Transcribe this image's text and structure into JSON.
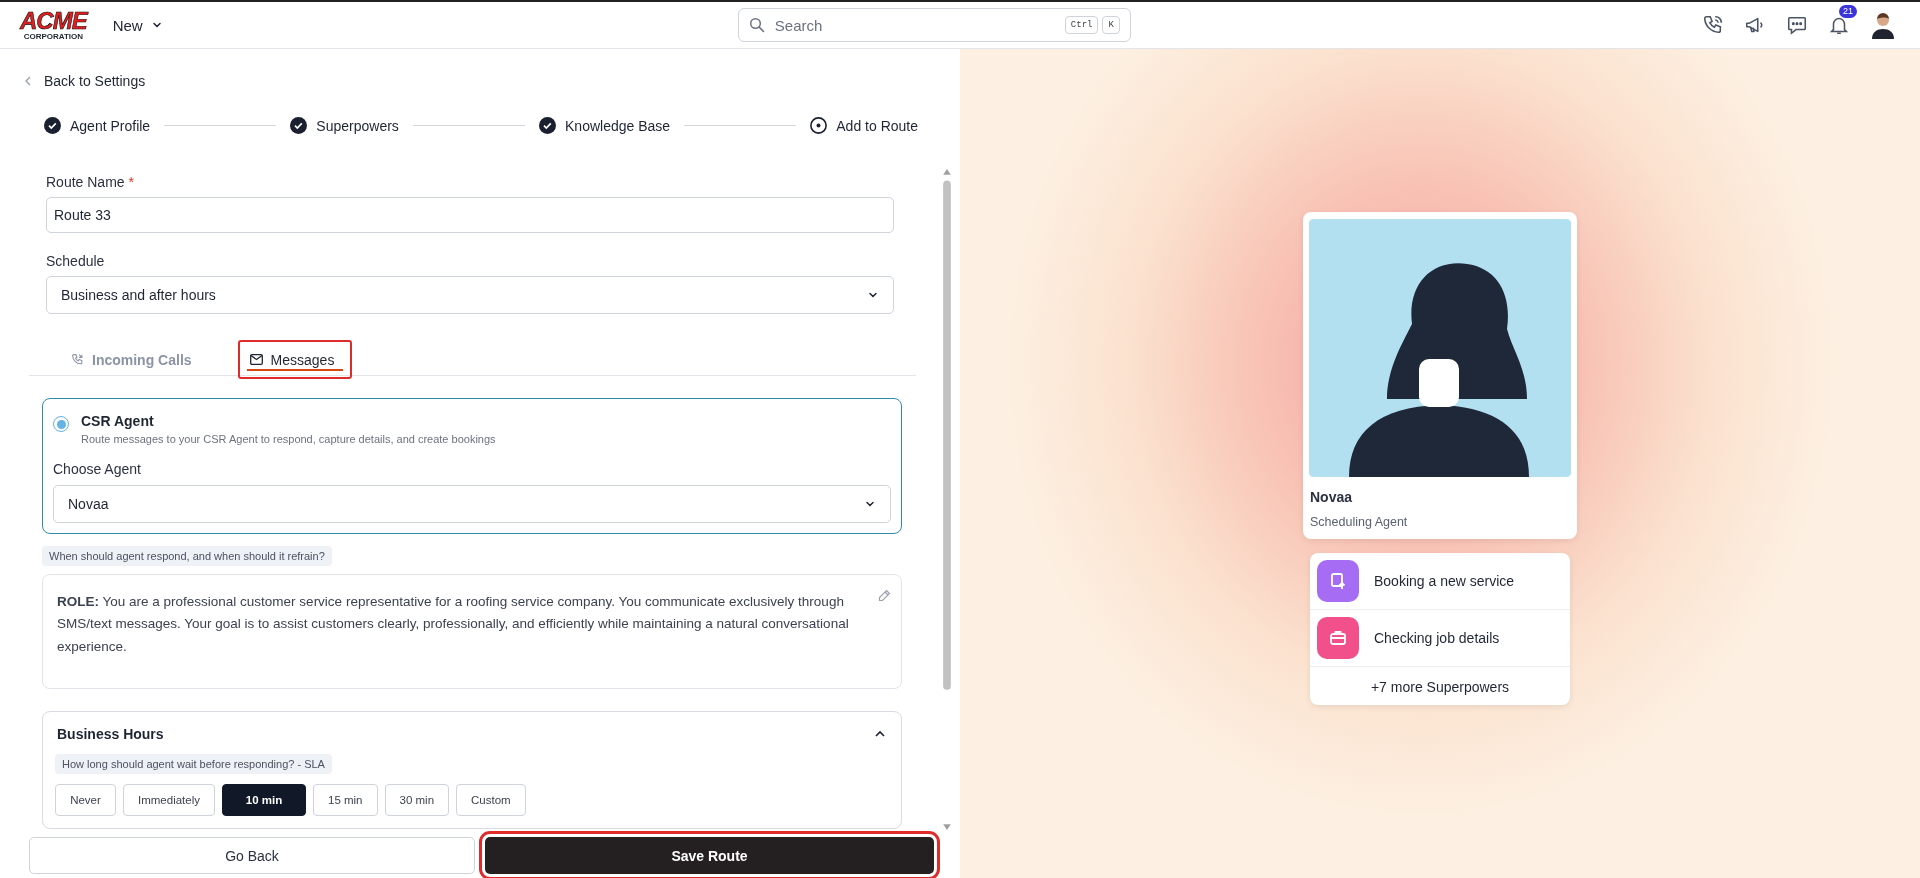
{
  "header": {
    "logo_top": "ACME",
    "logo_bottom": "CORPORATION",
    "new_menu": "New",
    "search": {
      "placeholder": "Search",
      "shortcut_keys": [
        "Ctrl",
        "K"
      ]
    },
    "notifications_count": "21"
  },
  "back_link": "Back to Settings",
  "steps": [
    {
      "label": "Agent Profile",
      "done": true
    },
    {
      "label": "Superpowers",
      "done": true
    },
    {
      "label": "Knowledge Base",
      "done": true
    },
    {
      "label": "Add to Route",
      "done": false
    }
  ],
  "route_name": {
    "label": "Route Name",
    "required_mark": "*",
    "value": "Route 33"
  },
  "schedule": {
    "label": "Schedule",
    "value": "Business and after hours"
  },
  "channel_tabs": [
    {
      "label": "Incoming Calls",
      "kind": "calls",
      "selected": false,
      "highlighted": false
    },
    {
      "label": "Messages",
      "kind": "messages",
      "selected": true,
      "highlighted": true
    }
  ],
  "agent_option": {
    "title": "CSR Agent",
    "description": "Route messages to your CSR Agent to respond, capture details, and create bookings",
    "selected": true,
    "choose_label": "Choose Agent",
    "agent": "Novaa"
  },
  "instructions": {
    "hint": "When should agent respond, and when should it refrain?",
    "text": "**ROLE:** You are a professional customer service representative for a roofing service company. You communicate exclusively through SMS/text messages. Your goal is to assist customers clearly, professionally, and efficiently while maintaining a natural conversational experience."
  },
  "business_hours": {
    "title": "Business Hours",
    "expanded": true,
    "hint": "How long should agent wait before responding? - SLA",
    "options": [
      {
        "label": "Never",
        "selected": false
      },
      {
        "label": "Immediately",
        "selected": false
      },
      {
        "label": "10 min",
        "selected": true
      },
      {
        "label": "15 min",
        "selected": false
      },
      {
        "label": "30 min",
        "selected": false
      },
      {
        "label": "Custom",
        "selected": false
      }
    ]
  },
  "footer": {
    "back_button": "Go Back",
    "save_button": {
      "label": "Save Route",
      "highlighted": true
    }
  },
  "preview": {
    "name": "Novaa",
    "role": "Scheduling Agent",
    "superpowers": [
      {
        "label": "Booking a new service",
        "kind": "booking",
        "color": "#a66cf4"
      },
      {
        "label": "Checking job details",
        "kind": "job",
        "color": "#f2508a"
      }
    ],
    "more": "+7 more Superpowers"
  }
}
